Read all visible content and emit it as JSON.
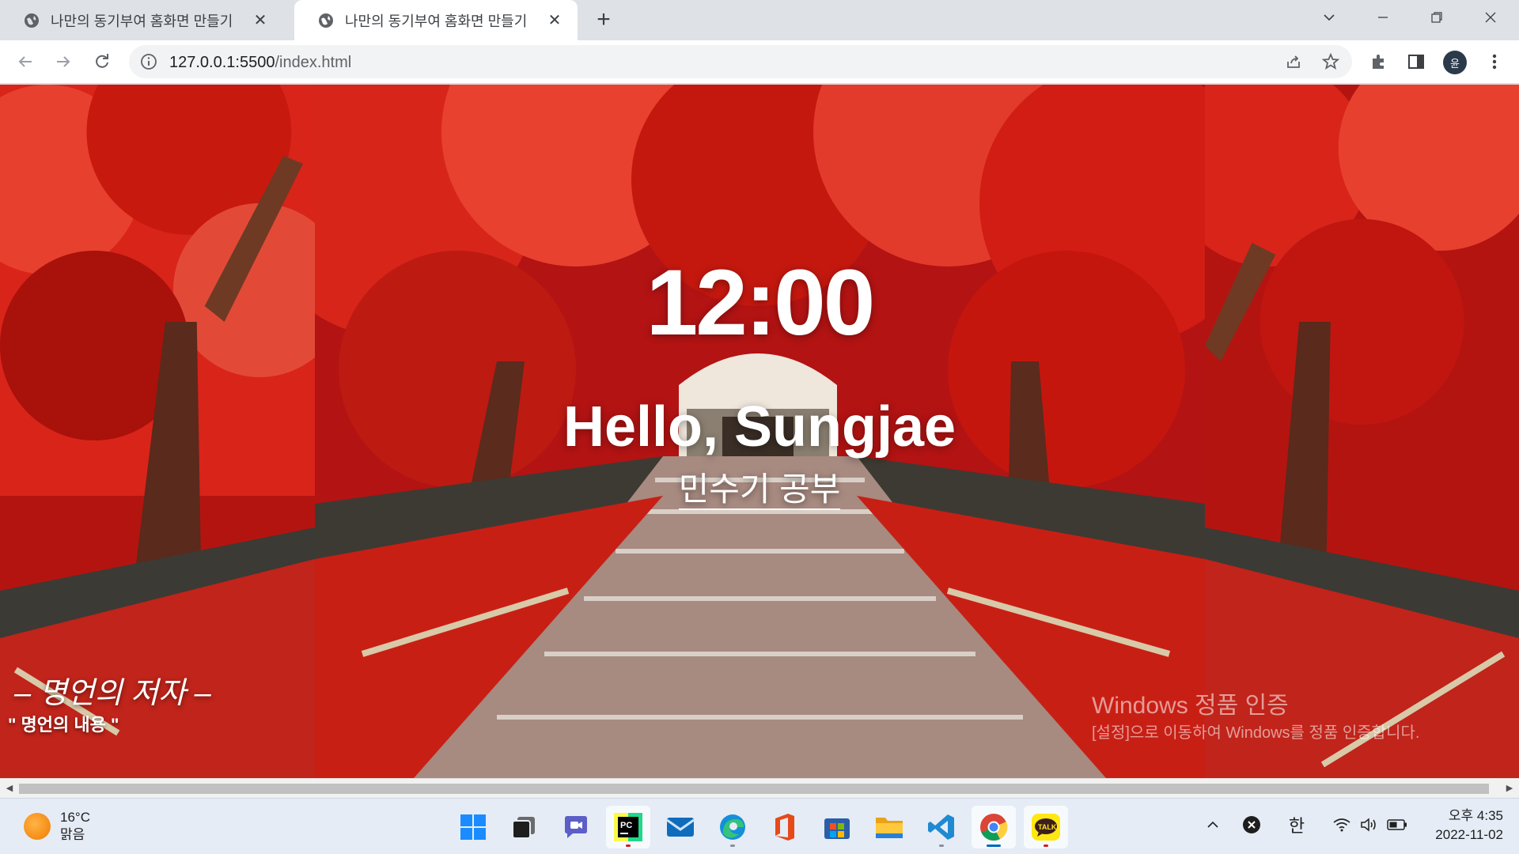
{
  "browser": {
    "tabs": [
      {
        "title": "나만의 동기부여 홈화면 만들기",
        "active": false
      },
      {
        "title": "나만의 동기부여 홈화면 만들기",
        "active": true
      }
    ],
    "new_tab_label": "+",
    "url_host": "127.0.0.1:5500",
    "url_path": "/index.html",
    "profile_initial": "윤"
  },
  "page": {
    "clock": "12:00",
    "greeting": "Hello, Sungjae",
    "todo": "민수기 공부",
    "quote_author": "– 명언의 저자 –",
    "quote_text": "\" 명언의 내용 \""
  },
  "watermark": {
    "title": "Windows 정품 인증",
    "subtitle": "[설정]으로 이동하여 Windows를 정품 인증합니다."
  },
  "taskbar": {
    "weather_temp": "16°C",
    "weather_desc": "맑음",
    "ime": "한",
    "time": "오후 4:35",
    "date": "2022-11-02",
    "apps": [
      "start-icon",
      "task-view-icon",
      "chat-icon",
      "pycharm-icon",
      "mail-icon",
      "edge-icon",
      "office-icon",
      "store-icon",
      "file-explorer-icon",
      "vscode-icon",
      "chrome-icon",
      "kakaotalk-icon"
    ],
    "kakao_label": "TALK",
    "pycharm_label": "PC"
  },
  "colors": {
    "autumn_red": "#c8190f",
    "chrome_tabbar": "#dee1e6",
    "taskbar_bg": "#e5ecf6"
  }
}
